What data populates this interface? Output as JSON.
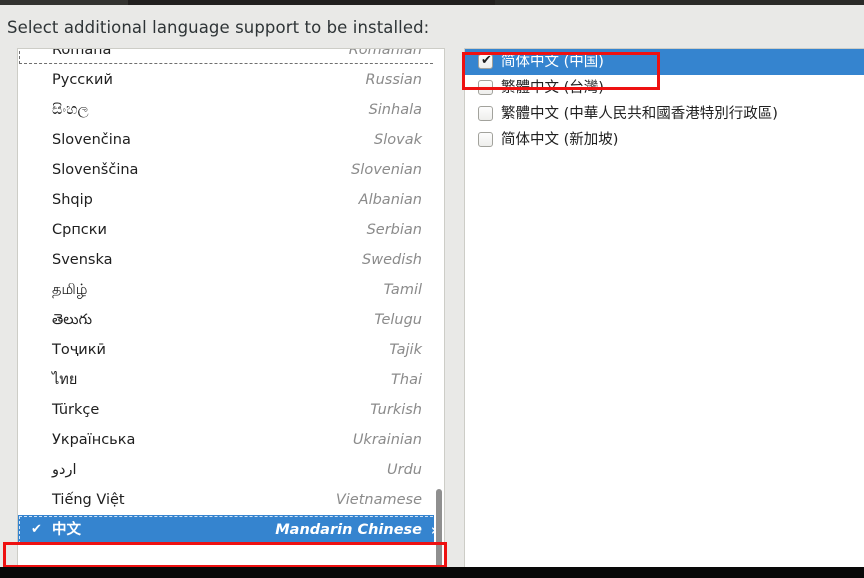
{
  "header": {
    "prompt": "Select additional language support to be installed:"
  },
  "language_list": {
    "scrollbar": "vertical-scrollbar",
    "items": [
      {
        "native": "Română",
        "english": "Romanian",
        "selected": false,
        "checked": false
      },
      {
        "native": "Русский",
        "english": "Russian",
        "selected": false,
        "checked": false
      },
      {
        "native": "සිංහල",
        "english": "Sinhala",
        "selected": false,
        "checked": false
      },
      {
        "native": "Slovenčina",
        "english": "Slovak",
        "selected": false,
        "checked": false
      },
      {
        "native": "Slovenščina",
        "english": "Slovenian",
        "selected": false,
        "checked": false
      },
      {
        "native": "Shqip",
        "english": "Albanian",
        "selected": false,
        "checked": false
      },
      {
        "native": "Српски",
        "english": "Serbian",
        "selected": false,
        "checked": false
      },
      {
        "native": "Svenska",
        "english": "Swedish",
        "selected": false,
        "checked": false
      },
      {
        "native": "தமிழ்",
        "english": "Tamil",
        "selected": false,
        "checked": false
      },
      {
        "native": "తెలుగు",
        "english": "Telugu",
        "selected": false,
        "checked": false
      },
      {
        "native": "Тоҷикӣ",
        "english": "Tajik",
        "selected": false,
        "checked": false
      },
      {
        "native": "ไทย",
        "english": "Thai",
        "selected": false,
        "checked": false
      },
      {
        "native": "Türkçe",
        "english": "Turkish",
        "selected": false,
        "checked": false
      },
      {
        "native": "Українська",
        "english": "Ukrainian",
        "selected": false,
        "checked": false
      },
      {
        "native": "اردو",
        "english": "Urdu",
        "selected": false,
        "checked": false
      },
      {
        "native": "Tiếng Việt",
        "english": "Vietnamese",
        "selected": false,
        "checked": false
      },
      {
        "native": "中文",
        "english": "Mandarin Chinese",
        "selected": true,
        "checked": true,
        "checkmark": "✔",
        "chevron": "›"
      }
    ]
  },
  "variant_list": {
    "items": [
      {
        "label": "简体中文 (中国)",
        "checked": true,
        "selected": true,
        "checkmark": "✔"
      },
      {
        "label": "繁體中文 (台灣)",
        "checked": false,
        "selected": false
      },
      {
        "label": "繁體中文 (中華人民共和國香港特別行政區)",
        "checked": false,
        "selected": false
      },
      {
        "label": "简体中文 (新加坡)",
        "checked": false,
        "selected": false
      }
    ]
  },
  "annotations": [
    {
      "name": "variant-highlight",
      "color": "#ee1111"
    },
    {
      "name": "language-highlight",
      "color": "#ee1111"
    }
  ]
}
